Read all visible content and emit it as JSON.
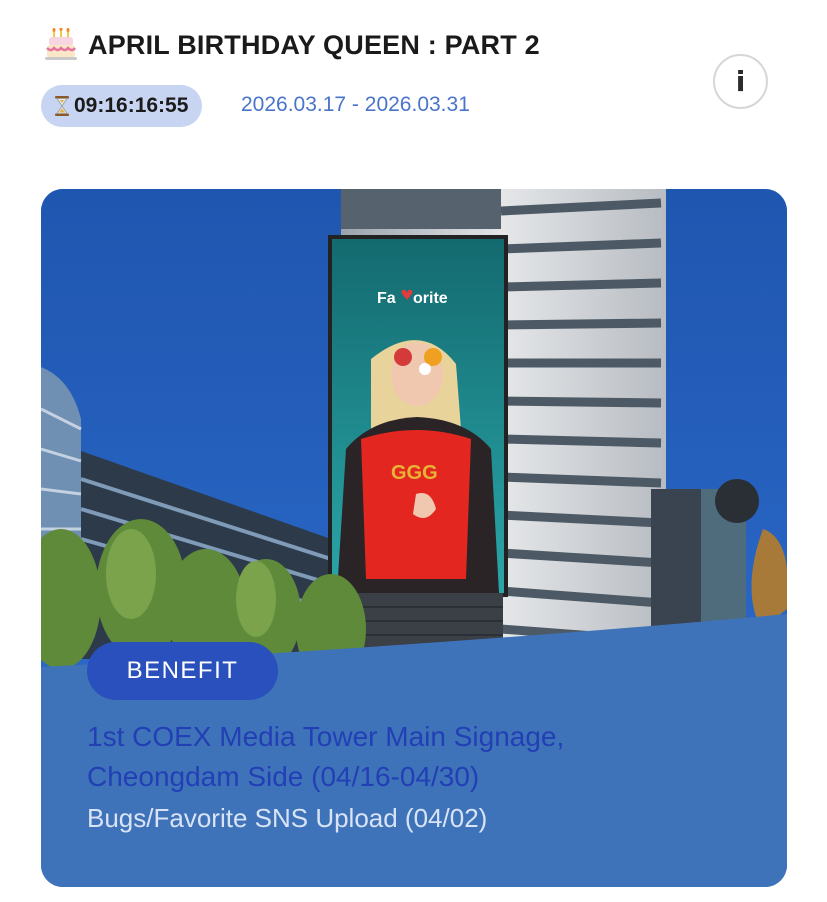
{
  "header": {
    "title": "APRIL BIRTHDAY QUEEN : PART 2",
    "timer": "09:16:16:55",
    "date_range": "2026.03.17 - 2026.03.31",
    "info_label": "i"
  },
  "card": {
    "billboard_logo_pre": "Fa",
    "billboard_logo_post": "orite",
    "badge": "BENEFIT",
    "title_line1": "1st COEX Media Tower Main Signage,",
    "title_line2": "Cheongdam Side (04/16-04/30)",
    "subtitle": "Bugs/Favorite SNS Upload (04/02)"
  },
  "colors": {
    "accent": "#2a50bd",
    "timer_bg": "#c8d5f2",
    "date_text": "#4a74c9",
    "card_bottom": "#3f73b9"
  },
  "icons": [
    "cake-icon",
    "hourglass-icon",
    "info-icon"
  ]
}
